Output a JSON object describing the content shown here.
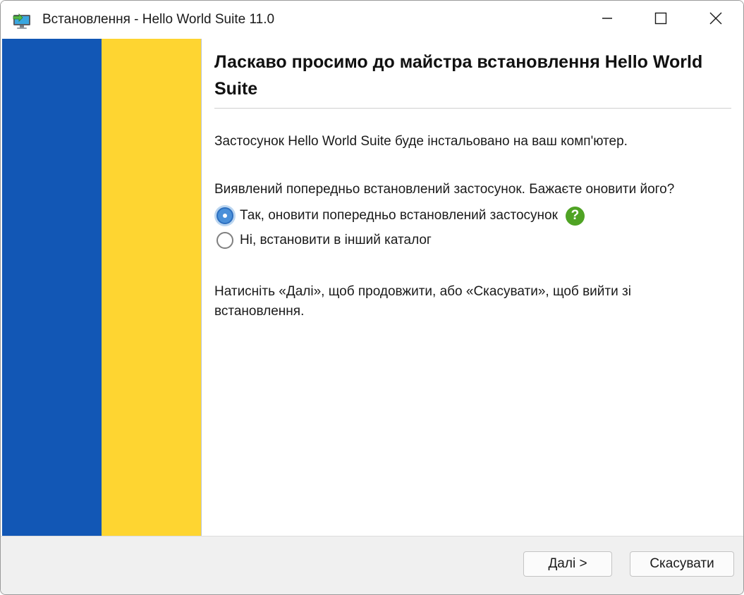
{
  "window": {
    "title": "Встановлення - Hello World Suite 11.0",
    "icon": "installer-computer-icon",
    "controls": [
      "minimize-icon",
      "maximize-icon",
      "close-icon"
    ]
  },
  "banner": {
    "colors": [
      "#1257b5",
      "#fed531"
    ]
  },
  "content": {
    "heading": "Ласкаво просимо до майстра встановлення Hello World Suite",
    "intro": "Застосунок Hello World Suite буде інстальовано на ваш комп'ютер.",
    "question": "Виявлений попередньо встановлений застосунок. Бажаєте оновити його?",
    "options": [
      {
        "label": "Так, оновити попередньо встановлений застосунок",
        "selected": true,
        "help_icon": "help-question-icon"
      },
      {
        "label": "Ні, встановити в інший каталог",
        "selected": false
      }
    ],
    "instruction": "Натисніть «Далі», щоб продовжити, або «Скасувати», щоб вийти зі встановлення."
  },
  "footer": {
    "next_label": "Далі >",
    "cancel_label": "Скасувати"
  },
  "colors": {
    "accent": "#4a90d9",
    "help": "#4fa324"
  }
}
